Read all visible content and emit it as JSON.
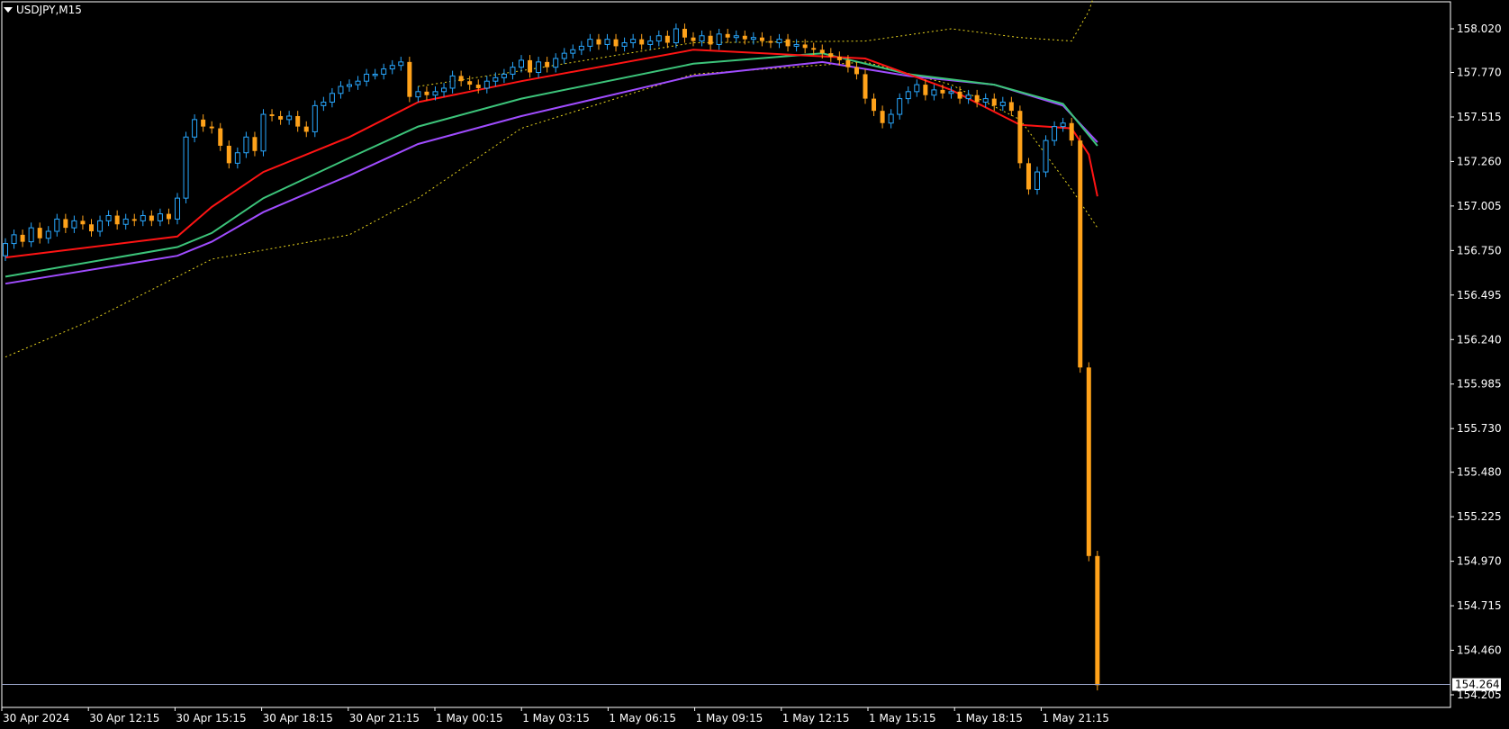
{
  "window": {
    "symbol_label": "USDJPY,M15"
  },
  "price_tag": "154.264",
  "colors": {
    "background": "#000000",
    "axis": "#ffffff",
    "bull": "#29a8ff",
    "bear": "#ffa21a",
    "ma_red": "#ff1414",
    "ma_green": "#3cc47a",
    "ma_purple": "#a04cff",
    "envelope": "#e6d21e",
    "price_line": "#9aa4c8"
  },
  "chart_data": {
    "type": "candlestick",
    "symbol": "USDJPY",
    "timeframe": "M15",
    "ylim": [
      154.12,
      158.28
    ],
    "y_ticks": [
      "158.020",
      "157.770",
      "157.515",
      "157.260",
      "157.005",
      "156.750",
      "156.495",
      "156.240",
      "155.985",
      "155.730",
      "155.480",
      "155.225",
      "154.970",
      "154.715",
      "154.460",
      "154.205"
    ],
    "x_ticks": [
      "30 Apr 2024",
      "30 Apr 12:15",
      "30 Apr 15:15",
      "30 Apr 18:15",
      "30 Apr 21:15",
      "1 May 00:15",
      "1 May 03:15",
      "1 May 06:15",
      "1 May 09:15",
      "1 May 12:15",
      "1 May 15:15",
      "1 May 18:15",
      "1 May 21:15"
    ],
    "last_price": 154.264,
    "candles_open_close": [
      [
        156.72,
        156.79
      ],
      [
        156.79,
        156.84
      ],
      [
        156.84,
        156.8
      ],
      [
        156.8,
        156.88
      ],
      [
        156.88,
        156.82
      ],
      [
        156.82,
        156.86
      ],
      [
        156.86,
        156.93
      ],
      [
        156.93,
        156.88
      ],
      [
        156.88,
        156.92
      ],
      [
        156.92,
        156.9
      ],
      [
        156.9,
        156.86
      ],
      [
        156.86,
        156.92
      ],
      [
        156.92,
        156.95
      ],
      [
        156.95,
        156.9
      ],
      [
        156.9,
        156.93
      ],
      [
        156.93,
        156.92
      ],
      [
        156.92,
        156.95
      ],
      [
        156.95,
        156.92
      ],
      [
        156.92,
        156.96
      ],
      [
        156.96,
        156.93
      ],
      [
        156.93,
        157.05
      ],
      [
        157.05,
        157.4
      ],
      [
        157.4,
        157.5
      ],
      [
        157.5,
        157.46
      ],
      [
        157.46,
        157.45
      ],
      [
        157.45,
        157.35
      ],
      [
        157.35,
        157.25
      ],
      [
        157.25,
        157.31
      ],
      [
        157.31,
        157.4
      ],
      [
        157.4,
        157.32
      ],
      [
        157.32,
        157.53
      ],
      [
        157.53,
        157.52
      ],
      [
        157.52,
        157.5
      ],
      [
        157.5,
        157.52
      ],
      [
        157.52,
        157.46
      ],
      [
        157.46,
        157.43
      ],
      [
        157.43,
        157.58
      ],
      [
        157.58,
        157.6
      ],
      [
        157.6,
        157.65
      ],
      [
        157.65,
        157.69
      ],
      [
        157.69,
        157.7
      ],
      [
        157.7,
        157.72
      ],
      [
        157.72,
        157.76
      ],
      [
        157.76,
        157.76
      ],
      [
        157.76,
        157.79
      ],
      [
        157.79,
        157.81
      ],
      [
        157.81,
        157.83
      ],
      [
        157.83,
        157.63
      ],
      [
        157.63,
        157.66
      ],
      [
        157.66,
        157.64
      ],
      [
        157.64,
        157.66
      ],
      [
        157.66,
        157.68
      ],
      [
        157.68,
        157.75
      ],
      [
        157.75,
        157.72
      ],
      [
        157.72,
        157.7
      ],
      [
        157.7,
        157.68
      ],
      [
        157.68,
        157.72
      ],
      [
        157.72,
        157.74
      ],
      [
        157.74,
        157.76
      ],
      [
        157.76,
        157.8
      ],
      [
        157.8,
        157.84
      ],
      [
        157.84,
        157.77
      ],
      [
        157.77,
        157.83
      ],
      [
        157.83,
        157.8
      ],
      [
        157.8,
        157.85
      ],
      [
        157.85,
        157.88
      ],
      [
        157.88,
        157.9
      ],
      [
        157.9,
        157.92
      ],
      [
        157.92,
        157.96
      ],
      [
        157.96,
        157.93
      ],
      [
        157.93,
        157.96
      ],
      [
        157.96,
        157.92
      ],
      [
        157.92,
        157.94
      ],
      [
        157.94,
        157.96
      ],
      [
        157.96,
        157.93
      ],
      [
        157.93,
        157.95
      ],
      [
        157.95,
        157.98
      ],
      [
        157.98,
        157.94
      ],
      [
        157.94,
        158.02
      ],
      [
        158.02,
        157.97
      ],
      [
        157.97,
        157.95
      ],
      [
        157.95,
        157.98
      ],
      [
        157.98,
        157.93
      ],
      [
        157.93,
        157.99
      ],
      [
        157.99,
        157.97
      ],
      [
        157.97,
        157.98
      ],
      [
        157.98,
        157.96
      ],
      [
        157.96,
        157.97
      ],
      [
        157.97,
        157.95
      ],
      [
        157.95,
        157.94
      ],
      [
        157.94,
        157.96
      ],
      [
        157.96,
        157.92
      ],
      [
        157.92,
        157.93
      ],
      [
        157.93,
        157.91
      ],
      [
        157.91,
        157.9
      ],
      [
        157.9,
        157.88
      ],
      [
        157.88,
        157.86
      ],
      [
        157.86,
        157.84
      ],
      [
        157.84,
        157.8
      ],
      [
        157.8,
        157.76
      ],
      [
        157.76,
        157.62
      ],
      [
        157.62,
        157.55
      ],
      [
        157.55,
        157.48
      ],
      [
        157.48,
        157.53
      ],
      [
        157.53,
        157.62
      ],
      [
        157.62,
        157.66
      ],
      [
        157.66,
        157.7
      ],
      [
        157.7,
        157.64
      ],
      [
        157.64,
        157.67
      ],
      [
        157.67,
        157.65
      ],
      [
        157.65,
        157.66
      ],
      [
        157.66,
        157.62
      ],
      [
        157.62,
        157.64
      ],
      [
        157.64,
        157.6
      ],
      [
        157.6,
        157.62
      ],
      [
        157.62,
        157.58
      ],
      [
        157.58,
        157.6
      ],
      [
        157.6,
        157.55
      ],
      [
        157.55,
        157.25
      ],
      [
        157.25,
        157.1
      ],
      [
        157.1,
        157.2
      ],
      [
        157.2,
        157.38
      ],
      [
        157.38,
        157.46
      ],
      [
        157.46,
        157.48
      ],
      [
        157.48,
        157.38
      ],
      [
        157.38,
        156.08
      ],
      [
        156.08,
        155.0
      ],
      [
        155.0,
        154.26
      ]
    ],
    "ma_red": [
      [
        0,
        156.71
      ],
      [
        20,
        156.83
      ],
      [
        24,
        157.0
      ],
      [
        30,
        157.2
      ],
      [
        40,
        157.4
      ],
      [
        48,
        157.6
      ],
      [
        60,
        157.72
      ],
      [
        80,
        157.9
      ],
      [
        100,
        157.85
      ],
      [
        110,
        157.67
      ],
      [
        118,
        157.47
      ],
      [
        124,
        157.45
      ],
      [
        126,
        157.3
      ],
      [
        127,
        157.06
      ]
    ],
    "ma_green": [
      [
        0,
        156.6
      ],
      [
        20,
        156.77
      ],
      [
        24,
        156.85
      ],
      [
        30,
        157.05
      ],
      [
        40,
        157.28
      ],
      [
        48,
        157.46
      ],
      [
        60,
        157.62
      ],
      [
        80,
        157.82
      ],
      [
        95,
        157.88
      ],
      [
        105,
        157.76
      ],
      [
        115,
        157.7
      ],
      [
        123,
        157.59
      ],
      [
        127,
        157.35
      ]
    ],
    "ma_purple": [
      [
        0,
        156.56
      ],
      [
        20,
        156.72
      ],
      [
        24,
        156.8
      ],
      [
        30,
        156.97
      ],
      [
        40,
        157.18
      ],
      [
        48,
        157.36
      ],
      [
        60,
        157.52
      ],
      [
        80,
        157.75
      ],
      [
        95,
        157.83
      ],
      [
        105,
        157.75
      ],
      [
        115,
        157.7
      ],
      [
        123,
        157.58
      ],
      [
        127,
        157.37
      ]
    ],
    "envelope_upper": [
      [
        48,
        157.69
      ],
      [
        60,
        157.78
      ],
      [
        80,
        157.94
      ],
      [
        100,
        157.95
      ],
      [
        110,
        158.02
      ],
      [
        118,
        157.97
      ],
      [
        124,
        157.95
      ],
      [
        126,
        158.12
      ],
      [
        127,
        158.27
      ]
    ],
    "envelope_lower": [
      [
        0,
        156.14
      ],
      [
        10,
        156.35
      ],
      [
        20,
        156.6
      ],
      [
        24,
        156.7
      ],
      [
        40,
        156.84
      ],
      [
        48,
        157.05
      ],
      [
        60,
        157.45
      ],
      [
        80,
        157.76
      ],
      [
        100,
        157.83
      ],
      [
        110,
        157.7
      ],
      [
        118,
        157.5
      ],
      [
        124,
        157.1
      ],
      [
        127,
        156.88
      ]
    ]
  }
}
